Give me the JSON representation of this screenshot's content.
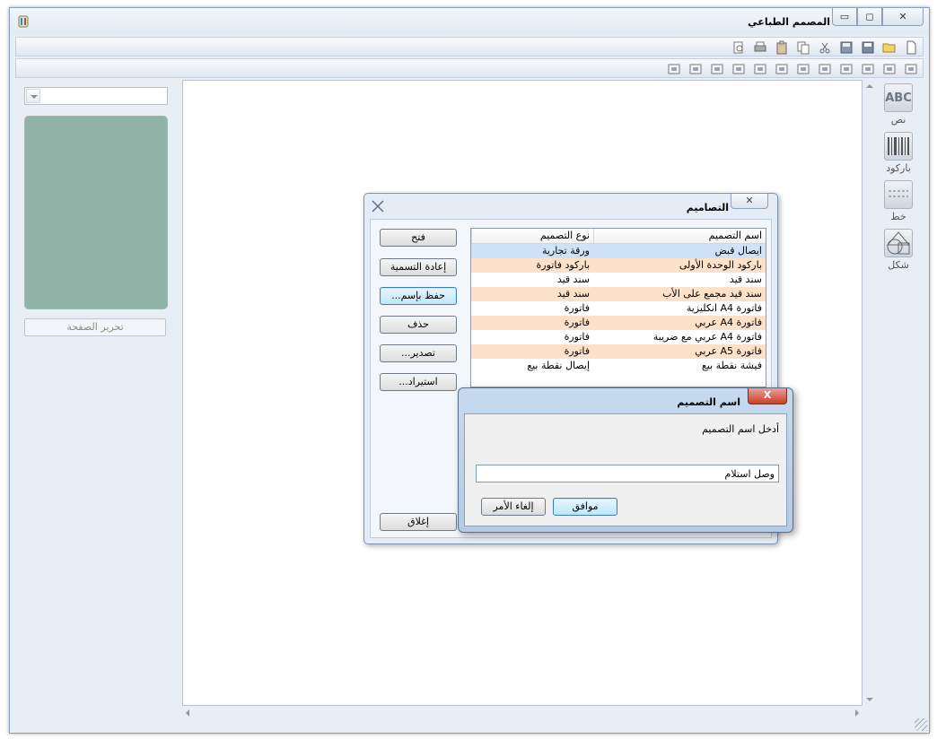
{
  "window": {
    "title": "المصمم الطباعي",
    "close_glyph": "✕",
    "restore_glyph": "◻",
    "minimize_glyph": "▭"
  },
  "toolbar1": [
    "new-file-icon",
    "open-folder-icon",
    "save-icon",
    "save-as-icon",
    "cut-icon",
    "copy-icon",
    "paste-icon",
    "print-icon",
    "print-preview-icon"
  ],
  "toolbar2": [
    "align-right-icon",
    "align-left-icon",
    "align-center-icon",
    "align-bottom-icon",
    "align-top-icon",
    "center-horizontal-icon",
    "center-vertical-icon",
    "same-width-icon",
    "same-height-icon",
    "same-size-icon",
    "bring-front-icon",
    "send-back-icon"
  ],
  "left_panel": {
    "page_edit_label": "تحرير الصفحة",
    "preview_color": "#90b3a8"
  },
  "palette": [
    {
      "label": "نص",
      "icon_text": "ABC"
    },
    {
      "label": "باركود",
      "icon_text": ""
    },
    {
      "label": "خط",
      "icon_text": ""
    },
    {
      "label": "شكل",
      "icon_text": ""
    }
  ],
  "designs_dialog": {
    "title": "التصاميم",
    "close_glyph": "✕",
    "buttons": {
      "open": "فتح",
      "rename": "إعادة التسمية",
      "save_as": "حفظ بإسم...",
      "delete": "حذف",
      "export": "تصدير...",
      "import": "استيراد...",
      "close": "إغلاق"
    },
    "columns": {
      "name": "اسم التصميم",
      "type": "نوع التصميم"
    },
    "rows": [
      {
        "name": "ايصال قبض",
        "type": "ورقة تجارية"
      },
      {
        "name": "باركود الوحدة الأولى",
        "type": "باركود فاتورة"
      },
      {
        "name": "سند قيد",
        "type": "سند قيد"
      },
      {
        "name": "سند قيد مجمع على الأب",
        "type": "سند قيد"
      },
      {
        "name": "فاتورة A4 انكليزية",
        "type": "فاتورة"
      },
      {
        "name": "فاتورة A4 عربي",
        "type": "فاتورة"
      },
      {
        "name": "فاتورة A4 عربي مع ضريبة",
        "type": "فاتورة"
      },
      {
        "name": "فاتورة A5 عربي",
        "type": "فاتورة"
      },
      {
        "name": "فيشة نقطة بيع",
        "type": "إيصال نقطة بيع"
      }
    ]
  },
  "name_dialog": {
    "title": "اسم التصميم",
    "close_glyph": "X",
    "prompt": "أدخل اسم التصميم",
    "input_value": "وصل استلام",
    "ok": "موافق",
    "cancel": "إلغاء الأمر"
  }
}
